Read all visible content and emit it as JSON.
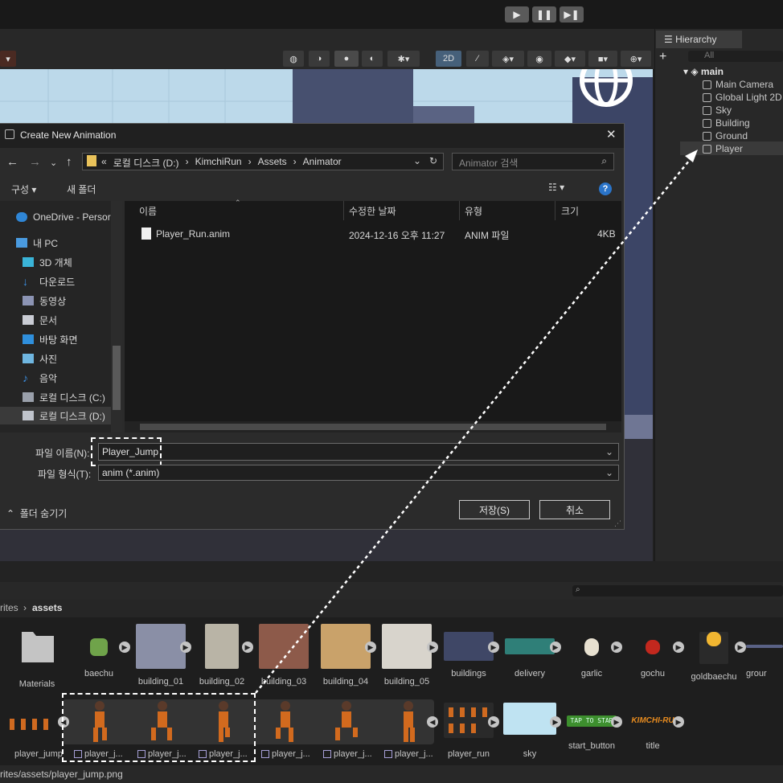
{
  "playbar": {
    "play": "▶",
    "pause": "❚❚",
    "step": "▶❚"
  },
  "scene_toolbar": {
    "mode_2d": "2D"
  },
  "hierarchy": {
    "tab_label": "Hierarchy",
    "add": "+",
    "search_placeholder": "All",
    "scene": "main",
    "items": [
      "Main Camera",
      "Global Light 2D",
      "Sky",
      "Building",
      "Ground",
      "Player"
    ]
  },
  "dialog": {
    "title": "Create New Animation",
    "close": "✕",
    "path": [
      "«",
      "로컬 디스크 (D:)",
      "KimchiRun",
      "Assets",
      "Animator"
    ],
    "search_placeholder": "Animator 검색",
    "organize": "구성 ▾",
    "new_folder": "새 폴더",
    "nav": [
      "OneDrive - Persor",
      "내 PC",
      "3D 개체",
      "다운로드",
      "동영상",
      "문서",
      "바탕 화면",
      "사진",
      "음악",
      "로컬 디스크 (C:)",
      "로컬 디스크 (D:)"
    ],
    "columns": {
      "name": "이름",
      "modified": "수정한 날짜",
      "type": "유형",
      "size": "크기"
    },
    "files": [
      {
        "name": "Player_Run.anim",
        "modified": "2024-12-16 오후 11:27",
        "type": "ANIM 파일",
        "size": "4KB"
      }
    ],
    "filename_label": "파일 이름(N):",
    "filename_value": "Player_Jump",
    "filetype_label": "파일 형식(T):",
    "filetype_value": "anim (*.anim)",
    "hide_folders": "폴더 숨기기",
    "save": "저장(S)",
    "cancel": "취소"
  },
  "project": {
    "breadcrumb": [
      "rites",
      "assets"
    ],
    "assets": [
      "Materials",
      "baechu",
      "building_01",
      "building_02",
      "building_03",
      "building_04",
      "building_05",
      "buildings",
      "delivery",
      "garlic",
      "gochu",
      "goldbaechu",
      "grour"
    ],
    "row2": {
      "first": "player_jump",
      "frames": [
        "player_j...",
        "player_j...",
        "player_j...",
        "player_j...",
        "player_j...",
        "player_j..."
      ],
      "others": [
        "player_run",
        "sky",
        "start_button",
        "title"
      ]
    },
    "title_art": "KIMCHI-RU",
    "start_art": "TAP TO STAR",
    "status": "rites/assets/player_jump.png"
  }
}
